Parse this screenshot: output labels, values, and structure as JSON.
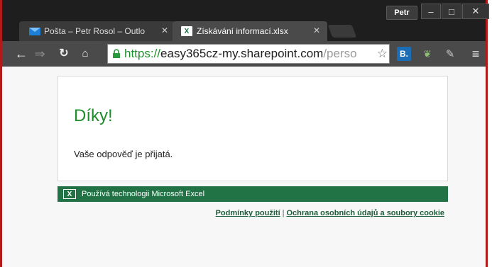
{
  "browser": {
    "user_name": "Petr",
    "window_controls": {
      "minimize": "–",
      "maximize": "□",
      "close": "✕"
    },
    "tabs": [
      {
        "label": "Pošta – Petr Rosol – Outlo",
        "icon": "mail-icon",
        "close": "✕"
      },
      {
        "label": "Získávání informací.xlsx",
        "icon": "excel-icon",
        "close": "✕"
      }
    ],
    "address": {
      "scheme": "https://",
      "host": "easy365cz-my.sharepoint.com",
      "path": "/perso"
    },
    "extensions": [
      "B.",
      "bird-icon",
      "note-icon"
    ]
  },
  "page": {
    "heading": "Díky!",
    "message": "Vaše odpověď je přijatá.",
    "powered_by": "Používá technologii Microsoft Excel",
    "footer": {
      "terms": "Podmínky použití",
      "separator": "|",
      "privacy": "Ochrana osobních údajů a soubory cookie"
    }
  },
  "colors": {
    "heading_green": "#1e8d2a",
    "excel_green": "#217346",
    "https_green": "#1f8f2e",
    "window_border": "#b21a1a"
  }
}
